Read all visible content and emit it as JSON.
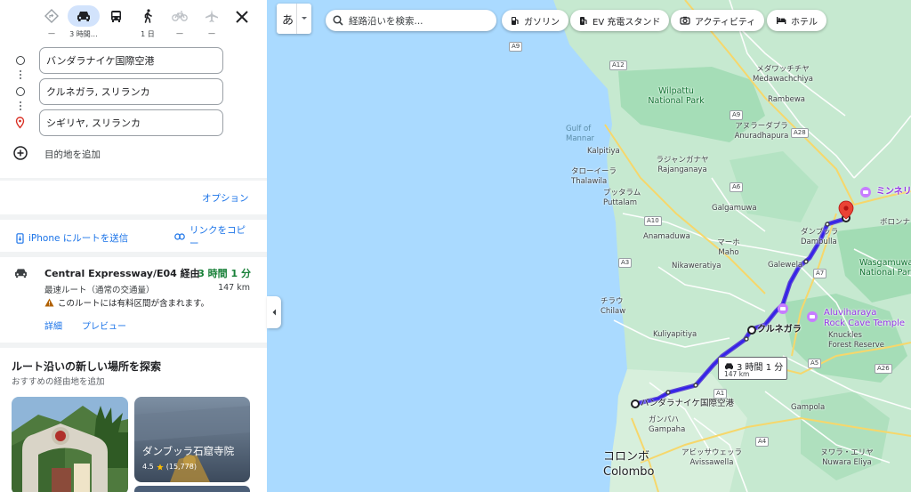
{
  "travel_modes": [
    {
      "name": "best",
      "label": "—"
    },
    {
      "name": "car",
      "label": "3 時間…"
    },
    {
      "name": "transit",
      "label": ""
    },
    {
      "name": "walk",
      "label": "1 日"
    },
    {
      "name": "bike",
      "label": "—"
    },
    {
      "name": "flight",
      "label": "—"
    }
  ],
  "waypoints": [
    "バンダラナイケ国際空港",
    "クルネガラ, スリランカ",
    "シギリヤ, スリランカ"
  ],
  "add_destination": "目的地を追加",
  "options_label": "オプション",
  "send_to_phone": "iPhone にルートを送信",
  "copy_link": "リンクをコピ\nー",
  "route": {
    "name": "Central Expressway/E04 経由",
    "duration": "3 時間 1 分",
    "subtitle": "最速ルート（通常の交通量）",
    "distance": "147 km",
    "warning": "このルートには有料区間が含まれます。",
    "details_link": "詳細",
    "preview_link": "プレビュー"
  },
  "explore": {
    "title": "ルート沿いの新しい場所を探索",
    "subtitle": "おすすめの経由地を追加",
    "cards": [
      {
        "title": "",
        "rating": "",
        "reviews": ""
      },
      {
        "title": "ダンブッラ石窟寺院",
        "rating": "4.5",
        "reviews": "(15,778)"
      }
    ]
  },
  "map": {
    "ime_label": "あ",
    "search_placeholder": "経路沿いを検索...",
    "chips": [
      "ガソリン",
      "EV 充電スタンド",
      "アクティビティ",
      "ホテル"
    ],
    "route_badge": {
      "time": "3 時間 1 分",
      "distance": "147 km"
    },
    "labels": {
      "gulf": "Gulf of\nMannar",
      "wilpattu": "Wilpattu\nNational Park",
      "medawachchiya": "メダワッチチヤ\nMedawachchiya",
      "rambewa": "Rambewa",
      "anuradhapura": "アヌラーダプラ\nAnuradhapura",
      "kalpitiya": "Kalpitiya",
      "rajanganaya": "ラジャンガナヤ\nRajanganaya",
      "thalawila": "タローイーラ\nThalawila",
      "puttalam": "プッタラム\nPuttalam",
      "galgamuwa": "Galgamuwa",
      "dambulla": "ダンブッラ\nDambulla",
      "polonnaruwa": "ボロンナ",
      "minneriya": "ミンネリ",
      "anamaduwa": "Anamaduwa",
      "maho": "マーホ\nMaho",
      "nikaweratiya": "Nikaweratiya",
      "galewela": "Galewela",
      "wasgamuwa": "Wasgamuwa\nNational Park",
      "chilaw": "チラウ\nChilaw",
      "aluviharaya": "Aluviharaya\nRock Cave Temple",
      "knuckles": "Knuckles\nForest Reserve",
      "kurunegala": "クルネガラ",
      "kuliyapitiya": "Kuliyapitiya",
      "airport": "バンダラナイケ国際空港",
      "gampaha": "ガンパハ\nGampaha",
      "gampola": "Gampola",
      "avissawella": "アビッサウェッラ\nAvissawella",
      "colombo": "コロンボ\nColombo",
      "nuwara_eliya": "ヌワラ・エリヤ\nNuwara Eliya"
    },
    "shields": [
      "A9",
      "A12",
      "A28",
      "A10",
      "A6",
      "A3",
      "A1",
      "A26",
      "A4",
      "A7",
      "A5",
      "A9"
    ]
  }
}
